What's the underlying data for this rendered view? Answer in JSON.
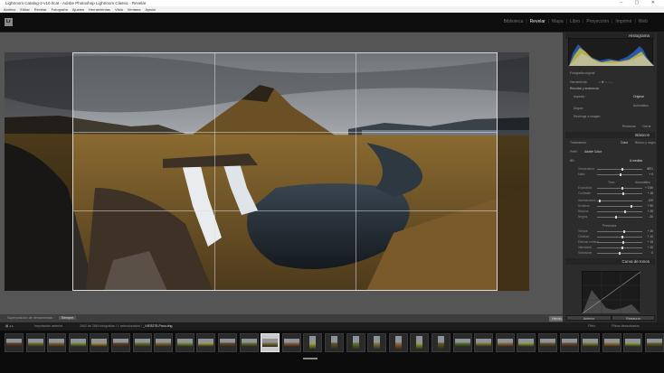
{
  "window": {
    "title": "Lightroom Catalog-2-v10.lrcat - Adobe Photoshop Lightroom Classic - Revelar",
    "controls": "– ▢ ✕"
  },
  "menu": [
    "Archivo",
    "Editar",
    "Revelar",
    "Fotografía",
    "Ajustes",
    "Herramientas",
    "Vista",
    "Ventana",
    "Ayuda"
  ],
  "app": {
    "logo": "Lr"
  },
  "modules": [
    {
      "label": "Biblioteca"
    },
    {
      "label": "Revelar",
      "active": true
    },
    {
      "label": "Mapa"
    },
    {
      "label": "Libro"
    },
    {
      "label": "Proyección"
    },
    {
      "label": "Imprimir"
    },
    {
      "label": "Web"
    }
  ],
  "toolbar": {
    "overlay_label": "Superposición de herramientas :",
    "overlay_value": "Siempre",
    "done_label": "Hecho"
  },
  "right_panel": {
    "histogram_title": "Histograma",
    "histogram_footer": "Fotografía original",
    "crop_label": "Herramienta",
    "crop_mode": "Recortar y enderezar",
    "aspect_label": "Aspecto :",
    "aspect_value": "Original",
    "angle_label": "Ángulo",
    "angle_auto": "Automático",
    "constrain_label": "Restringir a imagen",
    "reset_label": "Restaurar",
    "close_label": "Cerrar",
    "basic_title": "Básicos",
    "treatment_label": "Tratamiento :",
    "treatment_color": "Color",
    "treatment_bw": "Blanco y negro",
    "profile_label": "Perfil :",
    "profile_value": "Adobe Color",
    "wb_label": "BB :",
    "wb_value": "A medida",
    "tone_label": "Tono",
    "tone_auto": "Automático",
    "presence_label": "Presencia",
    "tonecurve_title": "Curva de tonos",
    "sliders": [
      {
        "label": "Temperatura",
        "value": "4871",
        "pos": 0.55
      },
      {
        "label": "Matiz",
        "value": "+ 6",
        "pos": 0.52
      },
      {
        "label": "Exposición",
        "value": "+ 0,50",
        "pos": 0.55
      },
      {
        "label": "Contraste",
        "value": "+ 18",
        "pos": 0.58
      },
      {
        "label": "Iluminaciones",
        "value": "- 100",
        "pos": 0.05
      },
      {
        "label": "Sombras",
        "value": "+ 50",
        "pos": 0.75
      },
      {
        "label": "Blancos",
        "value": "+ 25",
        "pos": 0.62
      },
      {
        "label": "Negros",
        "value": "- 20",
        "pos": 0.42
      },
      {
        "label": "Textura",
        "value": "+ 20",
        "pos": 0.6
      },
      {
        "label": "Claridad",
        "value": "+ 10",
        "pos": 0.55
      },
      {
        "label": "Eliminar neblina",
        "value": "+ 15",
        "pos": 0.57
      },
      {
        "label": "Intensidad",
        "value": "+ 10",
        "pos": 0.55
      },
      {
        "label": "Saturación",
        "value": "0",
        "pos": 0.5
      }
    ],
    "prev_button": "Anterior",
    "restore_button": "Restaurar"
  },
  "filmstrip": {
    "source": "Importación anterior",
    "count": "2842 de 2849 fotografías / 1 seleccionadas /",
    "filename": "_V4E8278-Pano.dng",
    "filter_label": "Filtro:",
    "filter_value": "Filtros desactivados"
  },
  "colors": {
    "accent": "#e6e6e6",
    "panel": "#2c2c2c",
    "canvas": "#555555"
  }
}
